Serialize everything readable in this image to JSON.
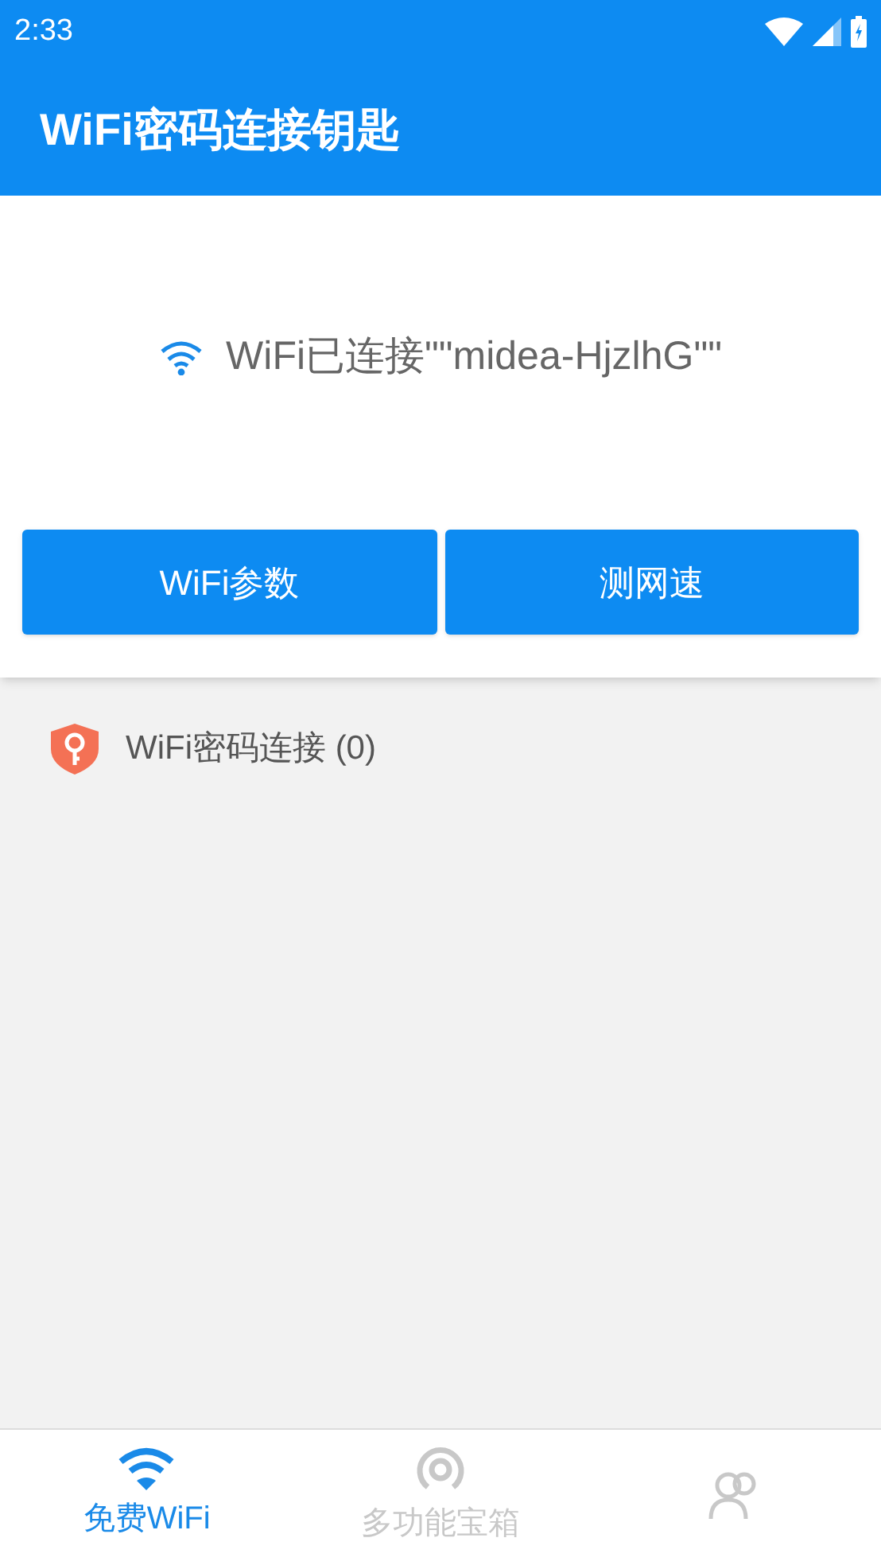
{
  "status_bar": {
    "time": "2:33"
  },
  "app_bar": {
    "title": "WiFi密码连接钥匙"
  },
  "connection": {
    "text": "WiFi已连接\"\"midea-HjzlhG\"\""
  },
  "buttons": [
    {
      "label": "WiFi参数"
    },
    {
      "label": "测网速"
    }
  ],
  "list": [
    {
      "label": "WiFi密码连接 (0)"
    }
  ],
  "bottom_nav": [
    {
      "kind": "wifi",
      "label": "免费WiFi",
      "selected": true
    },
    {
      "kind": "radar",
      "label": "多功能宝箱",
      "selected": false
    },
    {
      "kind": "people",
      "selected": false
    }
  ]
}
